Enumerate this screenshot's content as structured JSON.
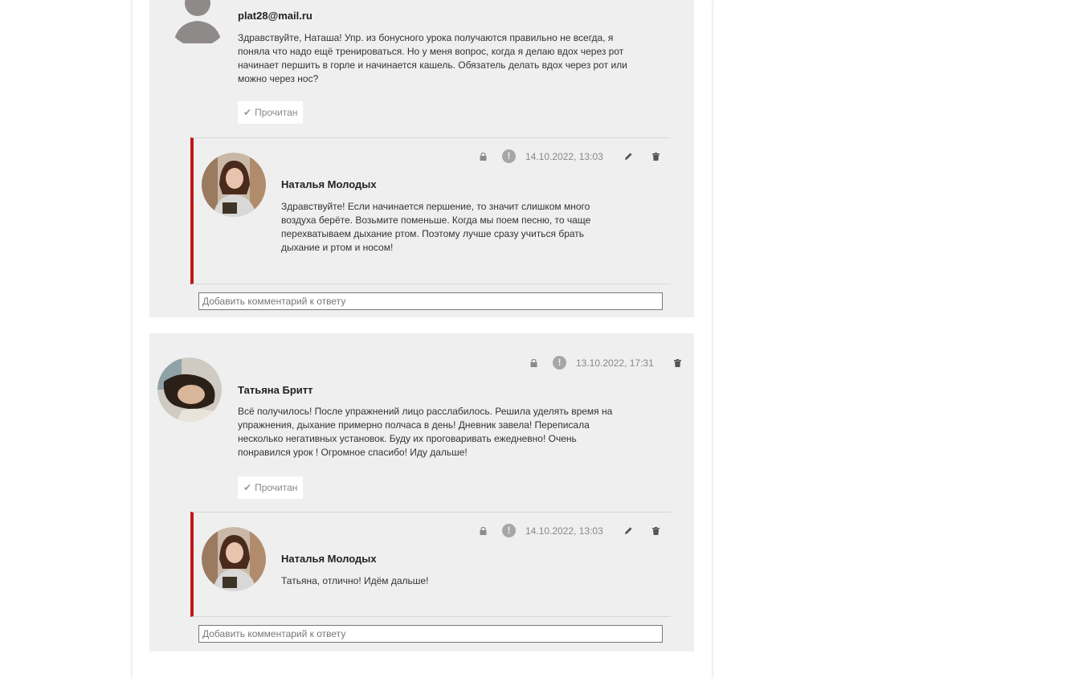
{
  "comments": [
    {
      "author": "plat28@mail.ru",
      "text": "Здравствуйте, Наташа! Упр. из бонусного урока получаются правильно не всегда, я поняла что надо ещё тренироваться. Но у меня вопрос, когда я делаю вдох через рот начинает першить в горле и начинается кашель. Обязатель делать вдох через рот или можно через нос?",
      "read_label": "Прочитан",
      "reply": {
        "author": "Наталья Молодых",
        "date": "14.10.2022, 13:03",
        "text": "Здравствуйте! Если начинается першение, то значит слишком много воздуха берёте. Возьмите поменьше. Когда мы поем песню, то чаще перехватываем дыхание ртом. Поэтому лучше сразу учиться брать дыхание и ртом и носом!"
      },
      "input_placeholder": "Добавить комментарий к ответу"
    },
    {
      "author": "Татьяна Бритт",
      "date": "13.10.2022, 17:31",
      "text": "Всё получилось! После упражнений лицо расслабилось. Решила уделять время на упражнения, дыхание примерно полчаса в день! Дневник завела! Переписала несколько негативных установок. Буду их проговаривать ежедневно! Очень понравился урок ! Огромное спасибо! Иду дальше!",
      "read_label": "Прочитан",
      "reply": {
        "author": "Наталья Молодых",
        "date": "14.10.2022, 13:03",
        "text": "Татьяна, отлично! Идём дальше!"
      },
      "input_placeholder": "Добавить комментарий к ответу"
    }
  ],
  "icons": {
    "lock": "lock-icon",
    "exclamation": "!",
    "edit": "pencil-icon",
    "delete": "trash-icon",
    "check": "✔"
  },
  "colors": {
    "accent": "#c0151c",
    "block_bg": "#efefef"
  }
}
